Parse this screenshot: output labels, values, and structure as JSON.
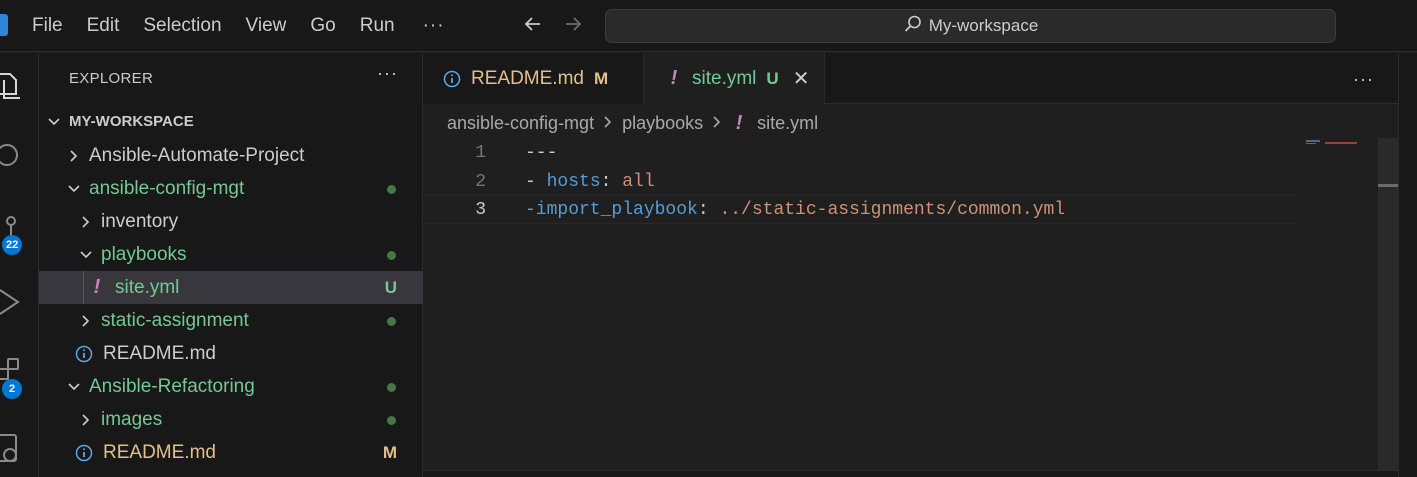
{
  "titlebar": {
    "menu": [
      "File",
      "Edit",
      "Selection",
      "View",
      "Go",
      "Run"
    ],
    "more": "···",
    "search_text": "My-workspace",
    "icons": [
      "back-arrow-icon",
      "forward-arrow-icon",
      "search-icon"
    ]
  },
  "activitybar": {
    "items": [
      "explorer-icon",
      "search-icon",
      "source-control-icon",
      "run-debug-icon",
      "extensions-icon",
      "remote-explorer-icon"
    ],
    "source_control_badge": "22",
    "extensions_badge": "2"
  },
  "sidebar": {
    "title": "EXPLORER",
    "more": "···",
    "workspace": "MY-WORKSPACE",
    "tree": [
      {
        "label": "Ansible-Automate-Project",
        "status": ""
      },
      {
        "label": "ansible-config-mgt",
        "status": "dot"
      },
      {
        "label": "inventory",
        "status": ""
      },
      {
        "label": "playbooks",
        "status": "dot"
      },
      {
        "label": "site.yml",
        "status": "U"
      },
      {
        "label": "static-assignment",
        "status": "dot"
      },
      {
        "label": "README.md",
        "status": ""
      },
      {
        "label": "Ansible-Refactoring",
        "status": "dot"
      },
      {
        "label": "images",
        "status": "dot"
      },
      {
        "label": "README.md",
        "status": "M"
      }
    ]
  },
  "tabs": [
    {
      "label": "README.md",
      "status": "M"
    },
    {
      "label": "site.yml",
      "status": "U",
      "close": "✕"
    }
  ],
  "tabs_more": "···",
  "breadcrumb": [
    "ansible-config-mgt",
    "playbooks",
    "site.yml"
  ],
  "editor": {
    "line_numbers": [
      "1",
      "2",
      "3"
    ],
    "line1": "---",
    "line2_dash": "- ",
    "line2_key": "hosts",
    "line2_colon": ": ",
    "line2_value": "all",
    "line3_key": "-import_playbook",
    "line3_colon": ": ",
    "line3_value": "../static-assignments/common.yml"
  },
  "colors": {
    "accent": "#0078d4",
    "git_untracked": "#73c991",
    "git_modified": "#e2c08d",
    "yaml_key": "#569cd6",
    "yaml_string": "#ce9178",
    "yaml_bang": "#c586c0"
  }
}
